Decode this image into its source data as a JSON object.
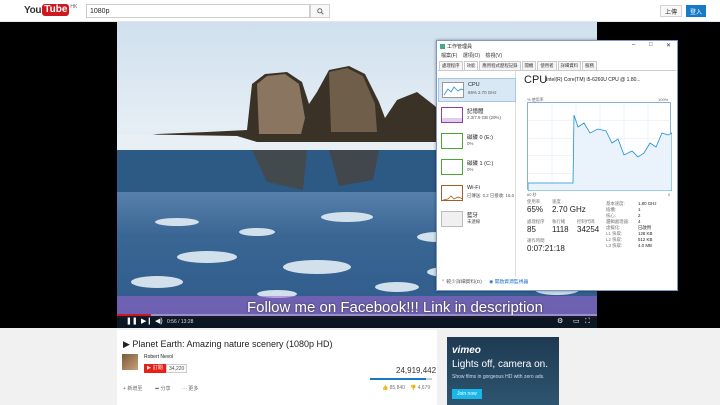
{
  "header": {
    "logo_you": "You",
    "logo_tube": "Tube",
    "logo_region": "HK",
    "search_value": "1080p",
    "upload_label": "上傳",
    "login_label": "登入"
  },
  "player": {
    "caption": "Follow me on Facebook!!! Link in description",
    "time": "0:56 / 13:28",
    "progress": 0.07
  },
  "video_info": {
    "title": "▶ Planet Earth: Amazing nature scenery (1080p HD)",
    "channel": "Robert Nevol",
    "subscribe_label": "訂閱",
    "subscriber_count": "34,220",
    "views": "24,919,442",
    "views_ratio": 0.9,
    "add_label": "新增至",
    "share_label": "分享",
    "more_label": "更多",
    "likes": "85,840",
    "dislikes": "4,679"
  },
  "ad": {
    "brand": "vimeo",
    "headline": "Lights off, camera on.",
    "sub": "Show films in gorgeous HD with zero ads.",
    "cta": "Join now"
  },
  "taskmgr": {
    "title": "工作管理員",
    "min": "–",
    "max": "□",
    "close": "✕",
    "menu": [
      "檔案(F)",
      "選項(O)",
      "檢視(V)"
    ],
    "tabs": [
      "處理程序",
      "效能",
      "應用程式歷程記錄",
      "開機",
      "使用者",
      "詳細資料",
      "服務"
    ],
    "resources": [
      {
        "name": "CPU",
        "value": "65% 2.70 GHz",
        "color": "#1e90d8"
      },
      {
        "name": "記憶體",
        "value": "2.3/7.9 GB (29%)",
        "color": "#8b3fb0"
      },
      {
        "name": "磁碟 0 (E:)",
        "value": "0%",
        "color": "#4aa832"
      },
      {
        "name": "磁碟 1 (C:)",
        "value": "0%",
        "color": "#4aa832"
      },
      {
        "name": "Wi-Fi",
        "value": "已傳送: 0.2 已接收: 16.0",
        "color": "#a06020"
      },
      {
        "name": "藍牙",
        "value": "未連線",
        "color": "#999999"
      }
    ],
    "cpu_header": "CPU",
    "cpu_model": "Intel(R) Core(TM) i5-6260U CPU @ 1.80...",
    "graph_label": "% 使用率",
    "graph_max": "100%",
    "graph_time": "60 秒",
    "graph_min": "0",
    "stats": {
      "usage_label": "使用率",
      "usage": "65%",
      "speed_label": "速度",
      "speed": "2.70 GHz",
      "proc_label": "處理程序",
      "proc": "85",
      "threads_label": "執行緒",
      "threads": "1118",
      "handles_label": "控制代碼",
      "handles": "34254",
      "uptime_label": "運作時間",
      "uptime": "0:07:21:18"
    },
    "specs": [
      {
        "k": "基本速度:",
        "v": "1.80 GHz"
      },
      {
        "k": "插槽:",
        "v": "1"
      },
      {
        "k": "核心:",
        "v": "2"
      },
      {
        "k": "邏輯處理器:",
        "v": "4"
      },
      {
        "k": "虛擬化:",
        "v": "已啟用"
      },
      {
        "k": "L1 快取:",
        "v": "128 KB"
      },
      {
        "k": "L2 快取:",
        "v": "512 KB"
      },
      {
        "k": "L3 快取:",
        "v": "4.0 MB"
      }
    ],
    "footer_less": "較少詳細資料(D)",
    "footer_link": "開啟資源監視器"
  }
}
